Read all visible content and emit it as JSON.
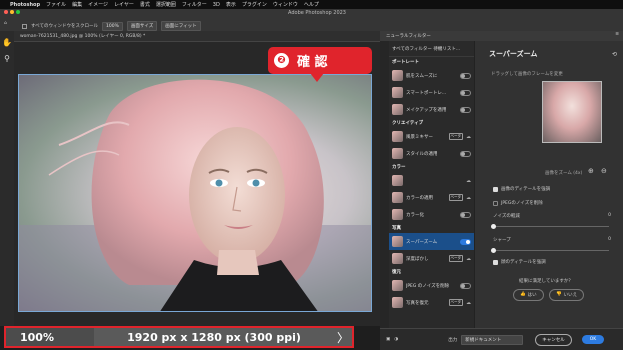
{
  "menubar": {
    "app": "Photoshop",
    "items": [
      "ファイル",
      "編集",
      "イメージ",
      "レイヤー",
      "書式",
      "選択範囲",
      "フィルター",
      "3D",
      "表示",
      "プラグイン",
      "ウィンドウ",
      "ヘルプ"
    ]
  },
  "window": {
    "title": "Adobe Photoshop 2023"
  },
  "options": {
    "scroll_all": "すべてのウィンドウをスクロール",
    "zoom": "100%",
    "fit_screen": "画面サイズ",
    "fill_screen": "画面にフィット"
  },
  "document": {
    "tab": "woman-7621531_480.jpg @ 100% (レイヤー 0, RGB/8) *"
  },
  "status": {
    "zoom": "100%",
    "dimensions": "1920 px x 1280 px (300 ppi)",
    "arrow": "〉"
  },
  "callout": {
    "number": "❷",
    "text": "確 認"
  },
  "neural": {
    "panel_title": "ニューラルフィルター",
    "list_header": "すべてのフィルター 待機リスト...",
    "categories": [
      {
        "name": "ポートレート",
        "items": [
          {
            "label": "肌をスムーズに",
            "on": false
          },
          {
            "label": "スマートポートレ...",
            "on": false
          },
          {
            "label": "メイクアップを適用",
            "on": false
          }
        ]
      },
      {
        "name": "クリエイティブ",
        "items": [
          {
            "label": "風景ミキサー",
            "on": false,
            "beta": "ベータ"
          },
          {
            "label": "スタイルの適用",
            "on": false
          }
        ]
      },
      {
        "name": "カラー",
        "items": [
          {
            "label": "",
            "on": false
          },
          {
            "label": "カラーの適用",
            "on": false,
            "beta": "ベータ"
          },
          {
            "label": "カラー化",
            "on": false
          }
        ]
      },
      {
        "name": "写真",
        "items": [
          {
            "label": "スーパーズーム",
            "on": true
          },
          {
            "label": "深度ぼかし",
            "on": false,
            "beta": "ベータ"
          }
        ]
      },
      {
        "name": "復元",
        "items": [
          {
            "label": "JPEG のノイズを削除",
            "on": false
          },
          {
            "label": "写真を復元",
            "on": false,
            "beta": "ベータ"
          }
        ]
      }
    ],
    "detail": {
      "title": "スーパーズーム",
      "instruction": "ドラッグして画像のフレームを変更",
      "zoom_label": "画像をズーム (4x)",
      "opt_enhance": "画像のディテールを強調",
      "opt_jpeg": "JPEGのノイズを削除",
      "noise_label": "ノイズの軽減",
      "noise_value": "0",
      "sharpen_label": "シャープ",
      "sharpen_value": "0",
      "opt_face": "顔のディテールを強調",
      "feedback_q": "結果に満足していますか？",
      "yes": "はい",
      "no": "いいえ"
    },
    "footer": {
      "output_label": "出力",
      "output_value": "新規ドキュメント",
      "cancel": "キャンセル",
      "ok": "OK"
    }
  }
}
